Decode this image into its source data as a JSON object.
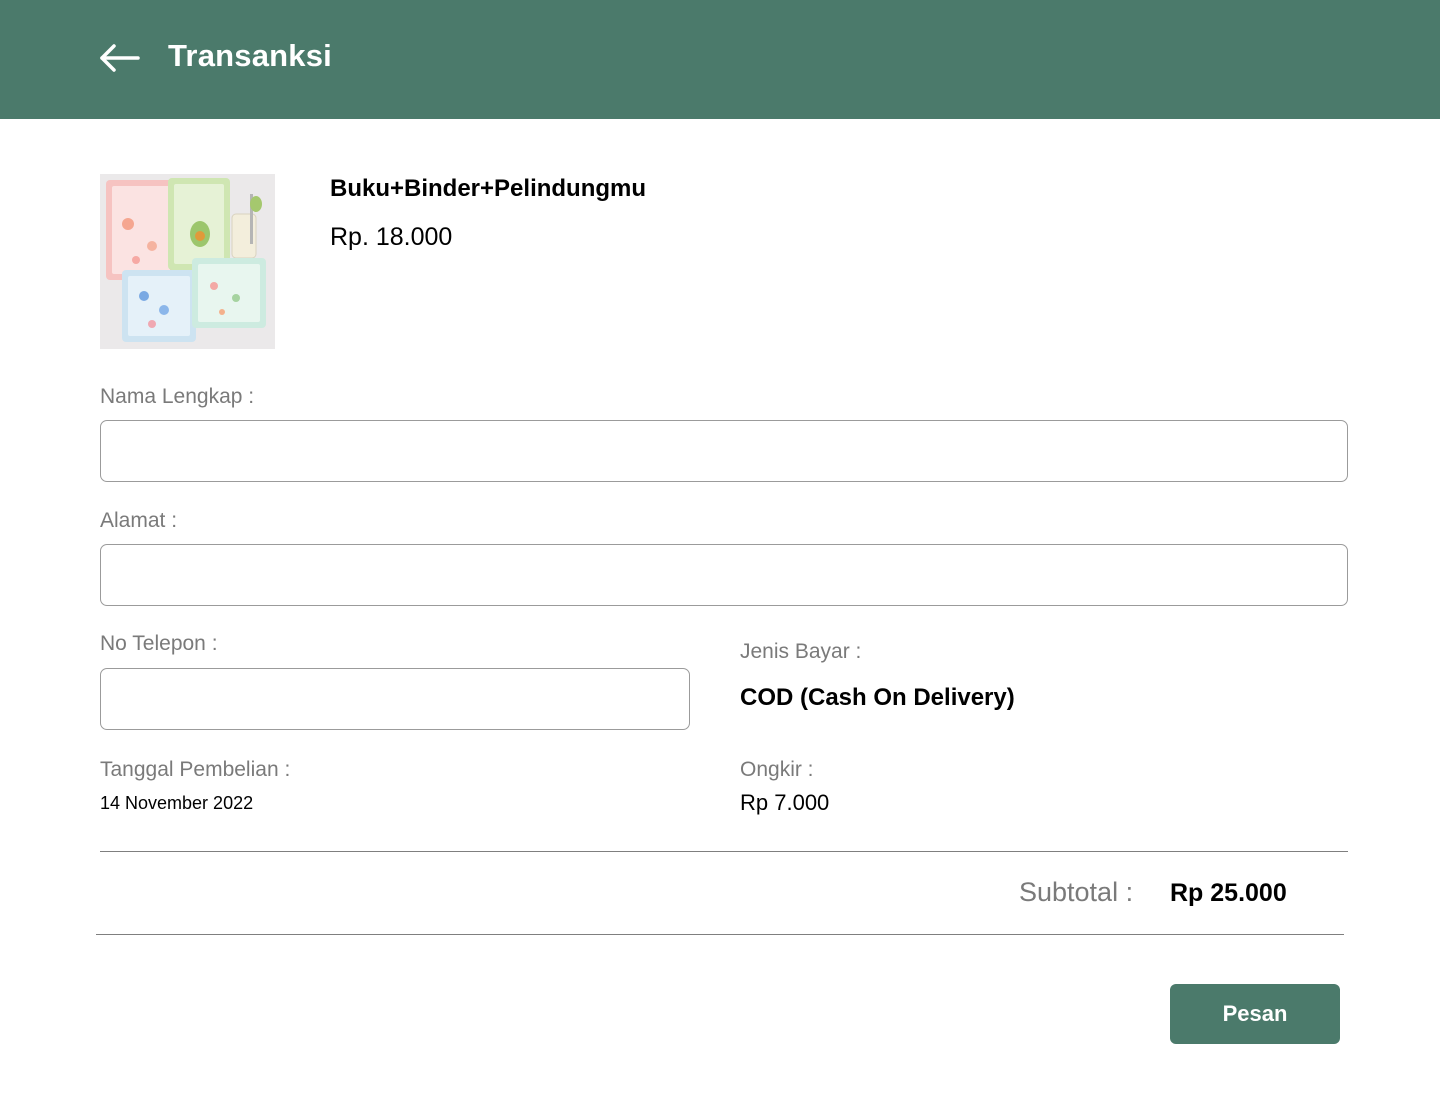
{
  "header": {
    "title": "Transanksi",
    "back_icon": "arrow-left-icon",
    "background": "#4b7a6b"
  },
  "product": {
    "name": "Buku+Binder+Pelindungmu",
    "price": "Rp. 18.000",
    "image_icon": "notebook-product-image"
  },
  "form": {
    "full_name_label": "Nama Lengkap :",
    "full_name_value": "",
    "address_label": "Alamat :",
    "address_value": "",
    "phone_label": "No Telepon :",
    "phone_value": "",
    "purchase_date_label": "Tanggal Pembelian :",
    "purchase_date_value": "14 November 2022",
    "payment_label": "Jenis Bayar :",
    "payment_value": "COD (Cash On Delivery)",
    "shipping_label": "Ongkir :",
    "shipping_value": "Rp 7.000"
  },
  "summary": {
    "subtotal_label": "Subtotal :",
    "subtotal_value": "Rp 25.000"
  },
  "actions": {
    "order_label": "Pesan"
  }
}
